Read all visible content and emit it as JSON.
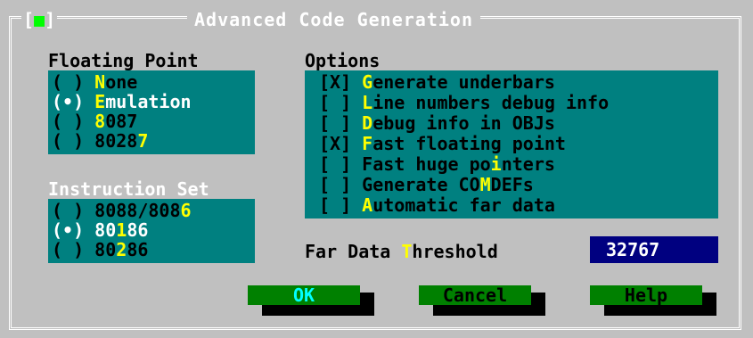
{
  "dialog": {
    "title": "Advanced Code Generation",
    "close_box_left": "[",
    "close_box_mark": "■",
    "close_box_right": "]"
  },
  "floating_point": {
    "label": "Floating Point",
    "options": [
      {
        "mark": "( )",
        "pre": "",
        "hotkey": "N",
        "post": "one",
        "selected": false
      },
      {
        "mark": "(•)",
        "pre": "",
        "hotkey": "E",
        "post": "mulation",
        "selected": true
      },
      {
        "mark": "( )",
        "pre": "",
        "hotkey": "8",
        "post": "087",
        "selected": false
      },
      {
        "mark": "( )",
        "pre": "8028",
        "hotkey": "7",
        "post": "",
        "selected": false
      }
    ]
  },
  "instruction_set": {
    "label": "Instruction Set",
    "options": [
      {
        "mark": "( )",
        "pre": "8088/808",
        "hotkey": "6",
        "post": "",
        "selected": false
      },
      {
        "mark": "(•)",
        "pre": "80",
        "hotkey": "1",
        "post": "86",
        "selected": true
      },
      {
        "mark": "( )",
        "pre": "80",
        "hotkey": "2",
        "post": "86",
        "selected": false
      }
    ]
  },
  "options": {
    "label": "Options",
    "items": [
      {
        "mark": "[X]",
        "pre": "",
        "hotkey": "G",
        "post": "enerate underbars"
      },
      {
        "mark": "[ ]",
        "pre": "",
        "hotkey": "L",
        "post": "ine numbers debug info"
      },
      {
        "mark": "[ ]",
        "pre": "",
        "hotkey": "D",
        "post": "ebug info in OBJs"
      },
      {
        "mark": "[X]",
        "pre": "",
        "hotkey": "F",
        "post": "ast floating point"
      },
      {
        "mark": "[ ]",
        "pre": "Fast huge po",
        "hotkey": "i",
        "post": "nters"
      },
      {
        "mark": "[ ]",
        "pre": "Generate CO",
        "hotkey": "M",
        "post": "DEFs"
      },
      {
        "mark": "[ ]",
        "pre": "",
        "hotkey": "A",
        "post": "utomatic far data"
      }
    ]
  },
  "far_data": {
    "label_pre": "Far Data ",
    "label_hotkey": "T",
    "label_post": "hreshold",
    "value": "32767"
  },
  "buttons": {
    "ok": "OK",
    "cancel": "Cancel",
    "help": "Help"
  },
  "colors": {
    "dialog_bg": "#c0c0c0",
    "panel_bg": "#008080",
    "hotkey": "#ffff00",
    "button_bg": "#008000",
    "input_bg": "#000080"
  }
}
